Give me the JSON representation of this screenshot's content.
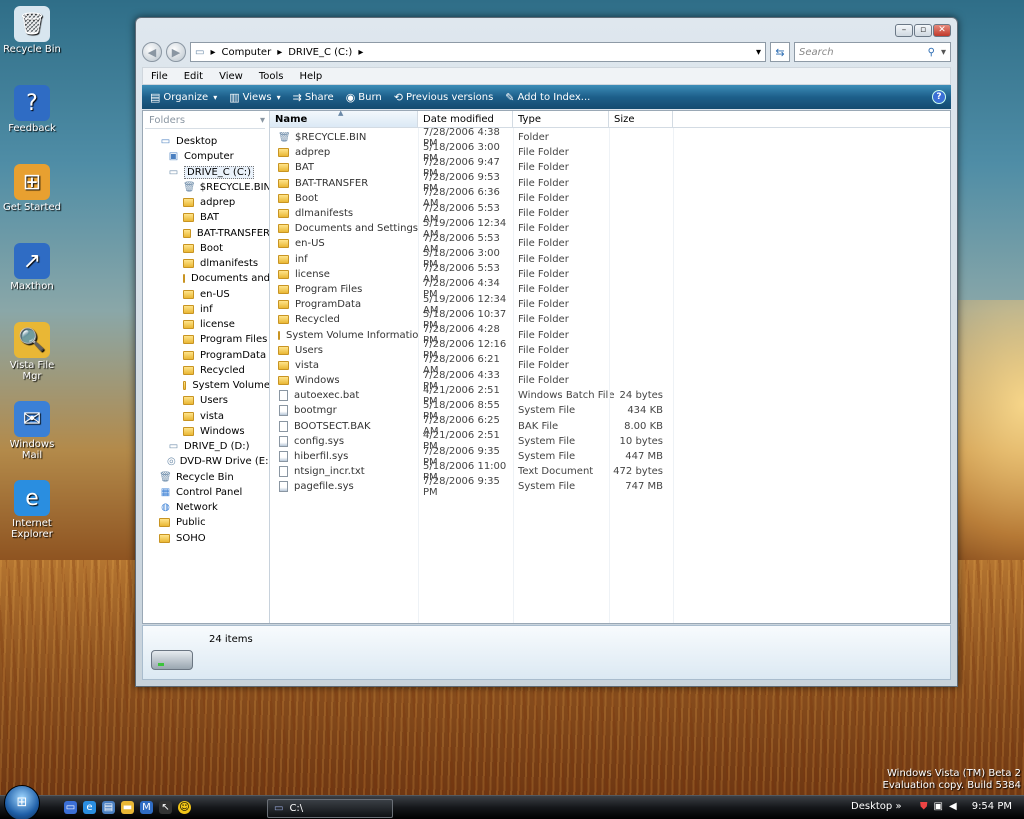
{
  "desktop": {
    "icons": [
      {
        "label": "Recycle Bin",
        "icon": "recycle-bin-icon"
      },
      {
        "label": "Feedback",
        "icon": "help-icon"
      },
      {
        "label": "Get Started",
        "icon": "windows-logo-icon"
      },
      {
        "label": "Maxthon",
        "icon": "maxthon-icon"
      },
      {
        "label": "Vista File Mgr",
        "icon": "folder-search-icon"
      },
      {
        "label": "Windows Mail",
        "icon": "mail-icon"
      },
      {
        "label": "Internet Explorer",
        "icon": "ie-icon"
      }
    ],
    "watermark_line1": "Windows Vista (TM) Beta 2",
    "watermark_line2": "Evaluation copy. Build 5384"
  },
  "window": {
    "address": {
      "seg1": "Computer",
      "seg2": "DRIVE_C (C:)",
      "sep": "▸"
    },
    "search": {
      "placeholder": "Search"
    },
    "menu": [
      "File",
      "Edit",
      "View",
      "Tools",
      "Help"
    ],
    "commands": [
      {
        "label": "Organize",
        "icon": "organize-icon",
        "dropdown": true
      },
      {
        "label": "Views",
        "icon": "views-icon",
        "dropdown": true
      },
      {
        "label": "Share",
        "icon": "share-icon",
        "dropdown": false
      },
      {
        "label": "Burn",
        "icon": "burn-icon",
        "dropdown": false
      },
      {
        "label": "Previous versions",
        "icon": "previous-versions-icon",
        "dropdown": false
      },
      {
        "label": "Add to Index...",
        "icon": "index-icon",
        "dropdown": false
      }
    ],
    "folders_header": "Folders",
    "tree": [
      {
        "label": "Desktop",
        "level": 1,
        "type": "desktop"
      },
      {
        "label": "Computer",
        "level": 2,
        "type": "computer"
      },
      {
        "label": "DRIVE_C (C:)",
        "level": 2,
        "type": "drive",
        "selected": true
      },
      {
        "label": "$RECYCLE.BIN",
        "level": 3,
        "type": "recycle"
      },
      {
        "label": "adprep",
        "level": 3,
        "type": "folder"
      },
      {
        "label": "BAT",
        "level": 3,
        "type": "folder"
      },
      {
        "label": "BAT-TRANSFER",
        "level": 3,
        "type": "folder"
      },
      {
        "label": "Boot",
        "level": 3,
        "type": "folder"
      },
      {
        "label": "dlmanifests",
        "level": 3,
        "type": "folder"
      },
      {
        "label": "Documents and",
        "level": 3,
        "type": "folder"
      },
      {
        "label": "en-US",
        "level": 3,
        "type": "folder"
      },
      {
        "label": "inf",
        "level": 3,
        "type": "folder"
      },
      {
        "label": "license",
        "level": 3,
        "type": "folder"
      },
      {
        "label": "Program Files",
        "level": 3,
        "type": "folder"
      },
      {
        "label": "ProgramData",
        "level": 3,
        "type": "folder"
      },
      {
        "label": "Recycled",
        "level": 3,
        "type": "folder"
      },
      {
        "label": "System Volume",
        "level": 3,
        "type": "folder"
      },
      {
        "label": "Users",
        "level": 3,
        "type": "folder"
      },
      {
        "label": "vista",
        "level": 3,
        "type": "folder"
      },
      {
        "label": "Windows",
        "level": 3,
        "type": "folder"
      },
      {
        "label": "DRIVE_D (D:)",
        "level": 2,
        "type": "drive"
      },
      {
        "label": "DVD-RW Drive (E:)",
        "level": 2,
        "type": "dvd"
      },
      {
        "label": "Recycle Bin",
        "level": 1,
        "type": "recycle"
      },
      {
        "label": "Control Panel",
        "level": 1,
        "type": "control"
      },
      {
        "label": "Network",
        "level": 1,
        "type": "network"
      },
      {
        "label": "Public",
        "level": 1,
        "type": "folder"
      },
      {
        "label": "SOHO",
        "level": 1,
        "type": "folder"
      }
    ],
    "columns": {
      "name": "Name",
      "date": "Date modified",
      "type": "Type",
      "size": "Size"
    },
    "files": [
      {
        "name": "$RECYCLE.BIN",
        "date": "7/28/2006 4:38 PM",
        "type": "Folder",
        "size": "",
        "kind": "recycle"
      },
      {
        "name": "adprep",
        "date": "5/18/2006 3:00 PM",
        "type": "File Folder",
        "size": "",
        "kind": "folder"
      },
      {
        "name": "BAT",
        "date": "7/28/2006 9:47 PM",
        "type": "File Folder",
        "size": "",
        "kind": "folder"
      },
      {
        "name": "BAT-TRANSFER",
        "date": "7/28/2006 9:53 PM",
        "type": "File Folder",
        "size": "",
        "kind": "folder"
      },
      {
        "name": "Boot",
        "date": "7/28/2006 6:36 AM",
        "type": "File Folder",
        "size": "",
        "kind": "folder"
      },
      {
        "name": "dlmanifests",
        "date": "7/28/2006 5:53 AM",
        "type": "File Folder",
        "size": "",
        "kind": "folder"
      },
      {
        "name": "Documents and Settings",
        "date": "5/19/2006 12:34 AM",
        "type": "File Folder",
        "size": "",
        "kind": "shortcut"
      },
      {
        "name": "en-US",
        "date": "7/28/2006 5:53 AM",
        "type": "File Folder",
        "size": "",
        "kind": "folder"
      },
      {
        "name": "inf",
        "date": "5/18/2006 3:00 PM",
        "type": "File Folder",
        "size": "",
        "kind": "folder"
      },
      {
        "name": "license",
        "date": "7/28/2006 5:53 AM",
        "type": "File Folder",
        "size": "",
        "kind": "folder"
      },
      {
        "name": "Program Files",
        "date": "7/28/2006 4:34 PM",
        "type": "File Folder",
        "size": "",
        "kind": "folder"
      },
      {
        "name": "ProgramData",
        "date": "5/19/2006 12:34 AM",
        "type": "File Folder",
        "size": "",
        "kind": "folder"
      },
      {
        "name": "Recycled",
        "date": "5/18/2006 10:37 PM",
        "type": "File Folder",
        "size": "",
        "kind": "folder"
      },
      {
        "name": "System Volume Information",
        "date": "7/28/2006 4:28 PM",
        "type": "File Folder",
        "size": "",
        "kind": "folder"
      },
      {
        "name": "Users",
        "date": "7/28/2006 12:16 PM",
        "type": "File Folder",
        "size": "",
        "kind": "folder"
      },
      {
        "name": "vista",
        "date": "7/28/2006 6:21 AM",
        "type": "File Folder",
        "size": "",
        "kind": "folder"
      },
      {
        "name": "Windows",
        "date": "7/28/2006 4:33 PM",
        "type": "File Folder",
        "size": "",
        "kind": "folder"
      },
      {
        "name": "autoexec.bat",
        "date": "4/21/2006 2:51 PM",
        "type": "Windows Batch File",
        "size": "24 bytes",
        "kind": "file"
      },
      {
        "name": "bootmgr",
        "date": "5/18/2006 8:55 PM",
        "type": "System File",
        "size": "434 KB",
        "kind": "sys"
      },
      {
        "name": "BOOTSECT.BAK",
        "date": "7/28/2006 6:25 AM",
        "type": "BAK File",
        "size": "8.00 KB",
        "kind": "file"
      },
      {
        "name": "config.sys",
        "date": "4/21/2006 2:51 PM",
        "type": "System File",
        "size": "10 bytes",
        "kind": "sys"
      },
      {
        "name": "hiberfil.sys",
        "date": "7/28/2006 9:35 PM",
        "type": "System File",
        "size": "447 MB",
        "kind": "sys"
      },
      {
        "name": "ntsign_incr.txt",
        "date": "5/18/2006 11:00 PM",
        "type": "Text Document",
        "size": "472 bytes",
        "kind": "file"
      },
      {
        "name": "pagefile.sys",
        "date": "7/28/2006 9:35 PM",
        "type": "System File",
        "size": "747 MB",
        "kind": "sys"
      }
    ],
    "status": {
      "items": "24 items"
    }
  },
  "taskbar": {
    "task_label": "C:\\",
    "tray_label": "Desktop",
    "clock": "9:54 PM"
  },
  "colors": {
    "cmdbar": "#1d5f8a",
    "folder": "#e9b735"
  }
}
